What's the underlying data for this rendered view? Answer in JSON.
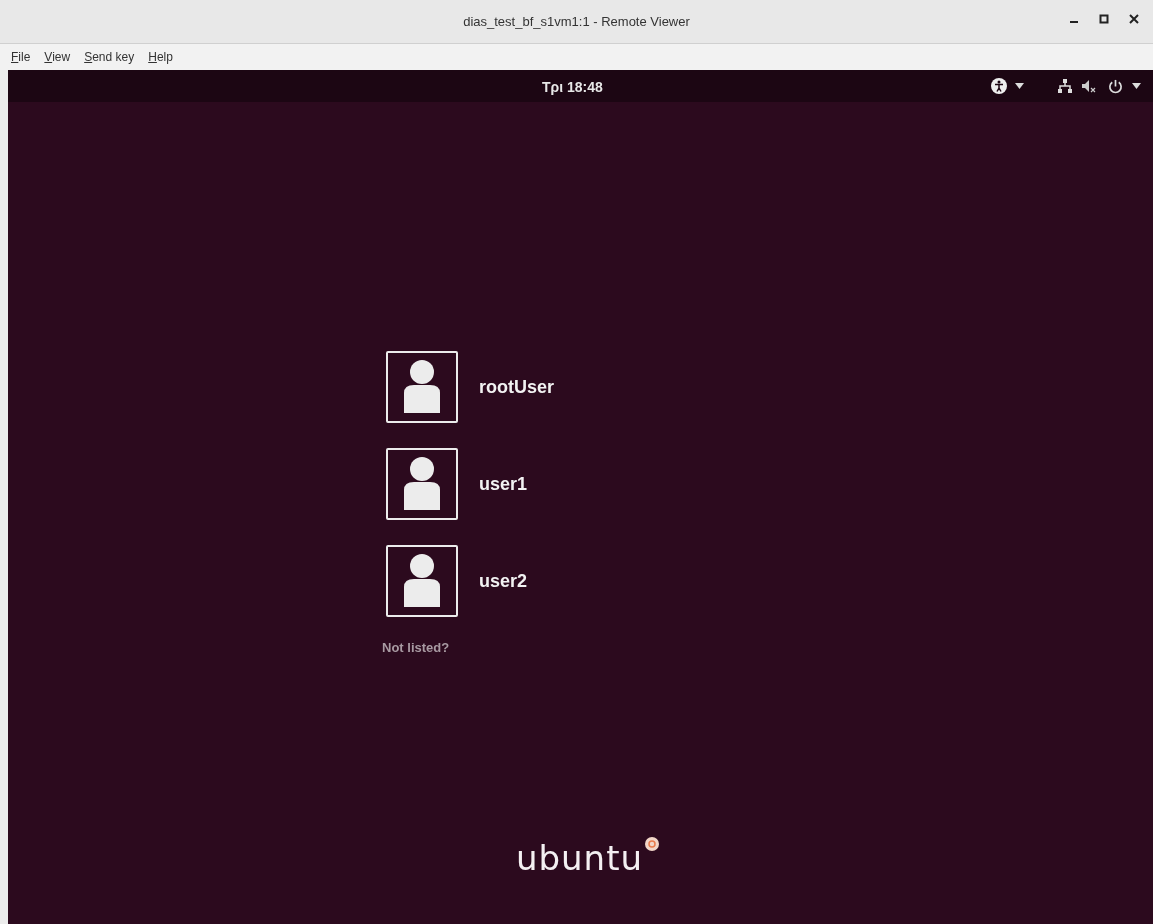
{
  "window": {
    "title": "dias_test_bf_s1vm1:1 - Remote Viewer"
  },
  "menu": [
    "File",
    "View",
    "Send key",
    "Help"
  ],
  "panel": {
    "clock": "Tρι 18:48"
  },
  "users": [
    {
      "name": "rootUser"
    },
    {
      "name": "user1"
    },
    {
      "name": "user2"
    }
  ],
  "not_listed": "Not listed?",
  "logo": "ubuntu"
}
